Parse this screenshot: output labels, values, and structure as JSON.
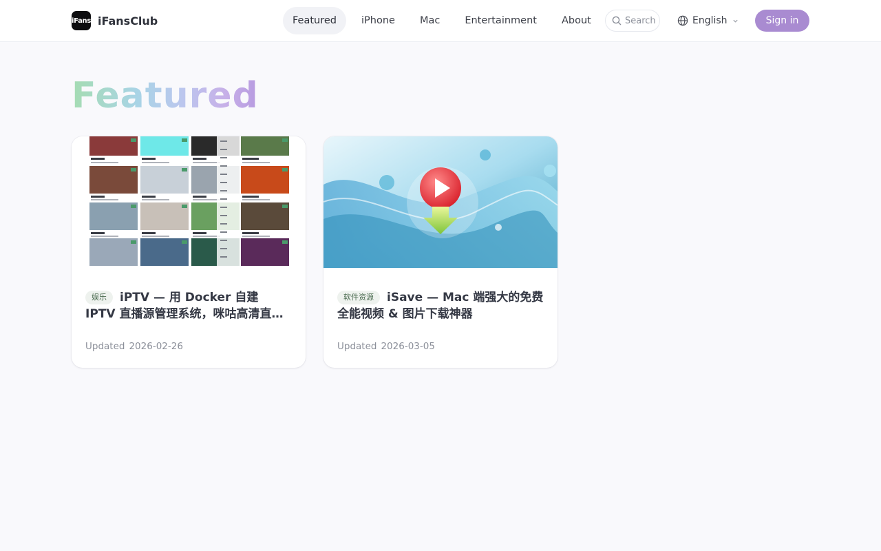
{
  "brand": {
    "logo_text": "iFans",
    "name": "iFansClub"
  },
  "nav": {
    "items": [
      {
        "label": "Featured",
        "active": true
      },
      {
        "label": "iPhone",
        "active": false
      },
      {
        "label": "Mac",
        "active": false
      },
      {
        "label": "Entertainment",
        "active": false
      },
      {
        "label": "About",
        "active": false
      }
    ]
  },
  "search": {
    "placeholder": "Search"
  },
  "language": {
    "label": "English"
  },
  "signin": {
    "label": "Sign in"
  },
  "page": {
    "title": "Featured"
  },
  "cards": [
    {
      "tag": "娱乐",
      "title": "iPTV — 用 Docker 自建 IPTV 直播源管理系统，咪咕高清直播源",
      "updated_label": "Updated",
      "date": "2026-02-26"
    },
    {
      "tag": "软件资源",
      "title": "iSave — Mac 端强大的免费全能视频 & 图片下载神器",
      "updated_label": "Updated",
      "date": "2026-03-05"
    }
  ],
  "colors": {
    "accent": "#a98bd1",
    "background": "#f9f9fc",
    "tag_bg": "#eef2ee"
  }
}
